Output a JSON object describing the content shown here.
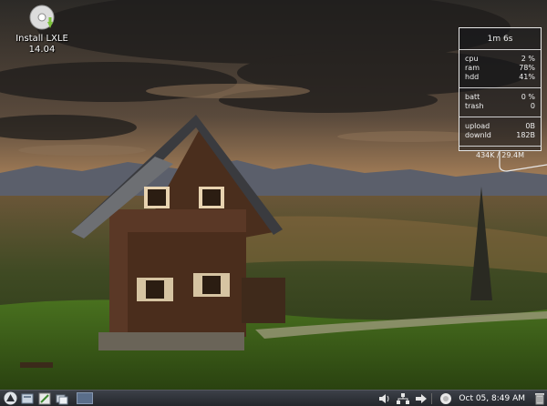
{
  "desktop": {
    "icons": [
      {
        "label_line1": "Install LXLE",
        "label_line2": "14.04"
      }
    ]
  },
  "conky": {
    "uptime": "1m 6s",
    "system": [
      {
        "label": "cpu",
        "value": "2 %"
      },
      {
        "label": "ram",
        "value": "78%"
      },
      {
        "label": "hdd",
        "value": "41%"
      }
    ],
    "misc": [
      {
        "label": "batt",
        "value": "0 %"
      },
      {
        "label": "trash",
        "value": "0"
      }
    ],
    "network": [
      {
        "label": "upload",
        "value": "0B"
      },
      {
        "label": "downld",
        "value": "182B"
      }
    ],
    "memory": "434K / 29.4M"
  },
  "taskbar": {
    "clock": "Oct 05,  8:49 AM",
    "launchers": [
      "lxle-menu-icon",
      "file-manager-icon",
      "text-editor-icon",
      "show-desktop-icon"
    ],
    "tray": [
      "volume-icon",
      "network-icon",
      "arrow-icon",
      "weather-icon",
      "trash-icon"
    ]
  },
  "colors": {
    "taskbar": "#2c2f35",
    "conky_border": "#e8e8e8"
  }
}
